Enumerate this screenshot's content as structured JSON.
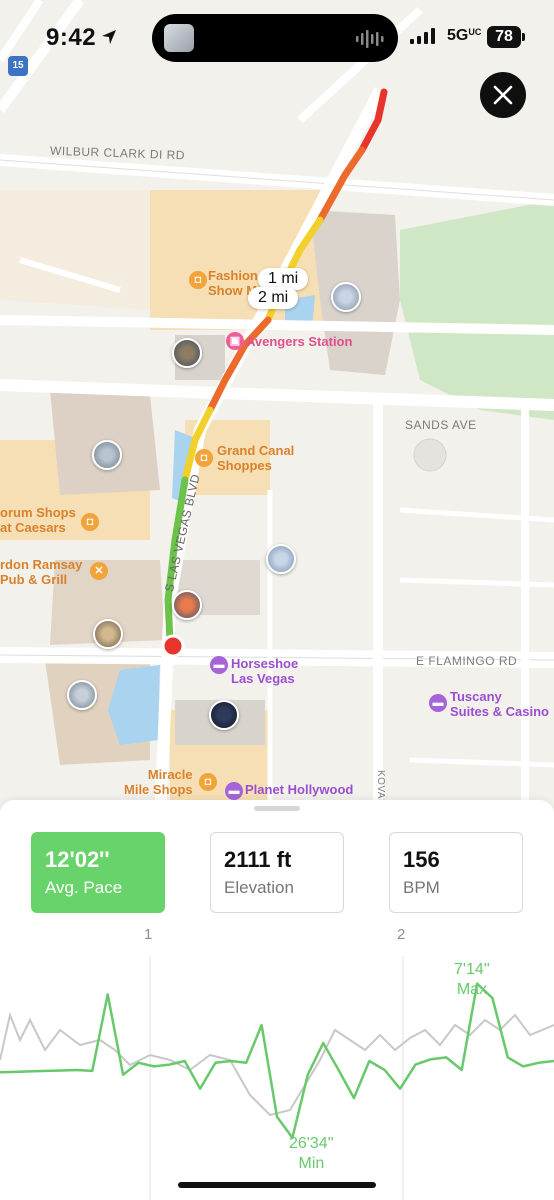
{
  "status_bar": {
    "time": "9:42",
    "network": "5G",
    "network_sub": "UC",
    "battery": "78"
  },
  "map": {
    "roads": {
      "wilbur_clark": "WILBUR CLARK DI RD",
      "sands_ave": "SANDS AVE",
      "las_vegas_blvd": "S LAS VEGAS BLVD",
      "flamingo": "E FLAMINGO RD",
      "koval": "KOVAL",
      "interstate": "15"
    },
    "pois": {
      "fashion_show_line1": "Fashion",
      "fashion_show_line2": "Show M",
      "avengers": "Avengers Station",
      "grand_canal_line1": "Grand Canal",
      "grand_canal_line2": "Shoppes",
      "forum_line1": "orum Shops",
      "forum_line2": "at Caesars",
      "ramsay_line1": "rdon Ramsay",
      "ramsay_line2": "Pub & Grill",
      "horseshoe_line1": "Horseshoe",
      "horseshoe_line2": "Las Vegas",
      "tuscany_line1": "Tuscany",
      "tuscany_line2": "Suites & Casino",
      "miracle_line1": "Miracle",
      "miracle_line2": "Mile Shops",
      "planet_hollywood": "Planet Hollywood"
    },
    "mile_markers": [
      "1 mi",
      "2 mi"
    ],
    "route_colors": {
      "fast": "#6cc24a",
      "medium": "#f2d02c",
      "slow": "#ec6a2c",
      "slowest": "#e8352c"
    }
  },
  "metrics": [
    {
      "value": "12'02''",
      "label": "Avg. Pace",
      "active": true
    },
    {
      "value": "2111 ft",
      "label": "Elevation",
      "active": false
    },
    {
      "value": "156",
      "label": "BPM",
      "active": false
    }
  ],
  "chart": {
    "mile_ticks": [
      "1",
      "2"
    ],
    "max_value": "7'14''",
    "max_label": "Max",
    "min_value": "26'34''",
    "min_label": "Min",
    "series_color": "#67c96b",
    "secondary_color": "#c8c8c8"
  },
  "chart_data": {
    "type": "line",
    "title": "",
    "series": [
      {
        "values": [
          12.5,
          12.4,
          12.3,
          12.2,
          12.1,
          12.0,
          12.2,
          7.8,
          13.0,
          11.6,
          11.8,
          11.7,
          11.5,
          16.0,
          11.6,
          11.5,
          11.6,
          9.5,
          22.0,
          26.5,
          13.0,
          10.5,
          12.0,
          18.0,
          11.5,
          12.0,
          16.0,
          11.7,
          11.4,
          11.3,
          12.0,
          7.2,
          8.0,
          11.3,
          11.8,
          11.6,
          11.5
        ]
      }
    ],
    "annotations": [
      {
        "label": "Max",
        "value": "7'14''"
      },
      {
        "label": "Min",
        "value": "26'34''"
      }
    ]
  }
}
